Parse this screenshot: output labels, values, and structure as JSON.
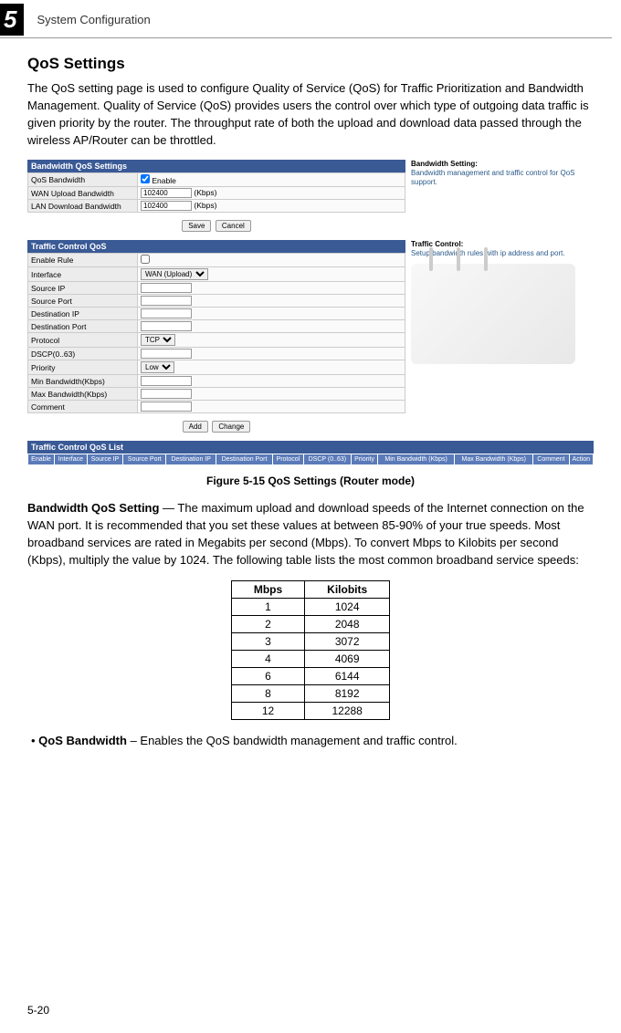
{
  "chapter": {
    "number": "5",
    "title": "System Configuration"
  },
  "section": {
    "title": "QoS Settings"
  },
  "intro": "The QoS setting page is used to configure Quality of Service (QoS) for Traffic Prioritization and Bandwidth Management. Quality of Service (QoS) provides users the control over which type of outgoing data traffic is given priority by the router. The throughput rate of both the upload and download data passed through the wireless AP/Router can be throttled.",
  "bandwidth_panel": {
    "header": "Bandwidth QoS Settings",
    "rows": {
      "qos_bw_label": "QoS Bandwidth",
      "qos_bw_enable": "Enable",
      "wan_upload_label": "WAN Upload Bandwidth",
      "wan_upload_value": "102400",
      "wan_upload_unit": "(Kbps)",
      "lan_dl_label": "LAN Download Bandwidth",
      "lan_dl_value": "102400",
      "lan_dl_unit": "(Kbps)"
    },
    "save_btn": "Save",
    "cancel_btn": "Cancel"
  },
  "help_bw": {
    "title": "Bandwidth Setting:",
    "text": "Bandwidth management and traffic control for QoS support."
  },
  "traffic_panel": {
    "header": "Traffic Control QoS",
    "rows": {
      "enable_rule": "Enable Rule",
      "interface": "Interface",
      "interface_value": "WAN (Upload)",
      "source_ip": "Source IP",
      "source_port": "Source Port",
      "dest_ip": "Destination IP",
      "dest_port": "Destination Port",
      "protocol": "Protocol",
      "protocol_value": "TCP",
      "dscp": "DSCP(0..63)",
      "priority": "Priority",
      "priority_value": "Low",
      "min_bw": "Min Bandwidth(Kbps)",
      "max_bw": "Max Bandwidth(Kbps)",
      "comment": "Comment"
    },
    "add_btn": "Add",
    "change_btn": "Change"
  },
  "help_tc": {
    "title": "Traffic Control:",
    "text": "Setup bandwidth rules with ip address and port."
  },
  "qos_list": {
    "header": "Traffic Control QoS List",
    "cols": [
      "Enable",
      "Interface",
      "Source IP",
      "Source Port",
      "Destination IP",
      "Destination Port",
      "Protocol",
      "DSCP (0..63)",
      "Priority",
      "Min Bandwidth (Kbps)",
      "Max Bandwidth (Kbps)",
      "Comment",
      "Action"
    ]
  },
  "figure_caption": "Figure 5-15  QoS Settings (Router mode)",
  "bandwidth_desc_label": "Bandwidth QoS Setting",
  "bandwidth_desc": " — The maximum upload and download speeds of the Internet connection on the WAN port. It is recommended that you set these values at between 85-90% of your true speeds. Most broadband services are rated in Megabits per second (Mbps). To convert Mbps to Kilobits per second (Kbps), multiply the value by 1024. The following table lists the most common broadband service speeds:",
  "chart_data": {
    "type": "table",
    "columns": [
      "Mbps",
      "Kilobits"
    ],
    "rows": [
      [
        "1",
        "1024"
      ],
      [
        "2",
        "2048"
      ],
      [
        "3",
        "3072"
      ],
      [
        "4",
        "4069"
      ],
      [
        "6",
        "6144"
      ],
      [
        "8",
        "8192"
      ],
      [
        "12",
        "12288"
      ]
    ]
  },
  "bullet1_label": "QoS Bandwidth",
  "bullet1_text": " – Enables the QoS bandwidth management and traffic control.",
  "page_number": "5-20"
}
